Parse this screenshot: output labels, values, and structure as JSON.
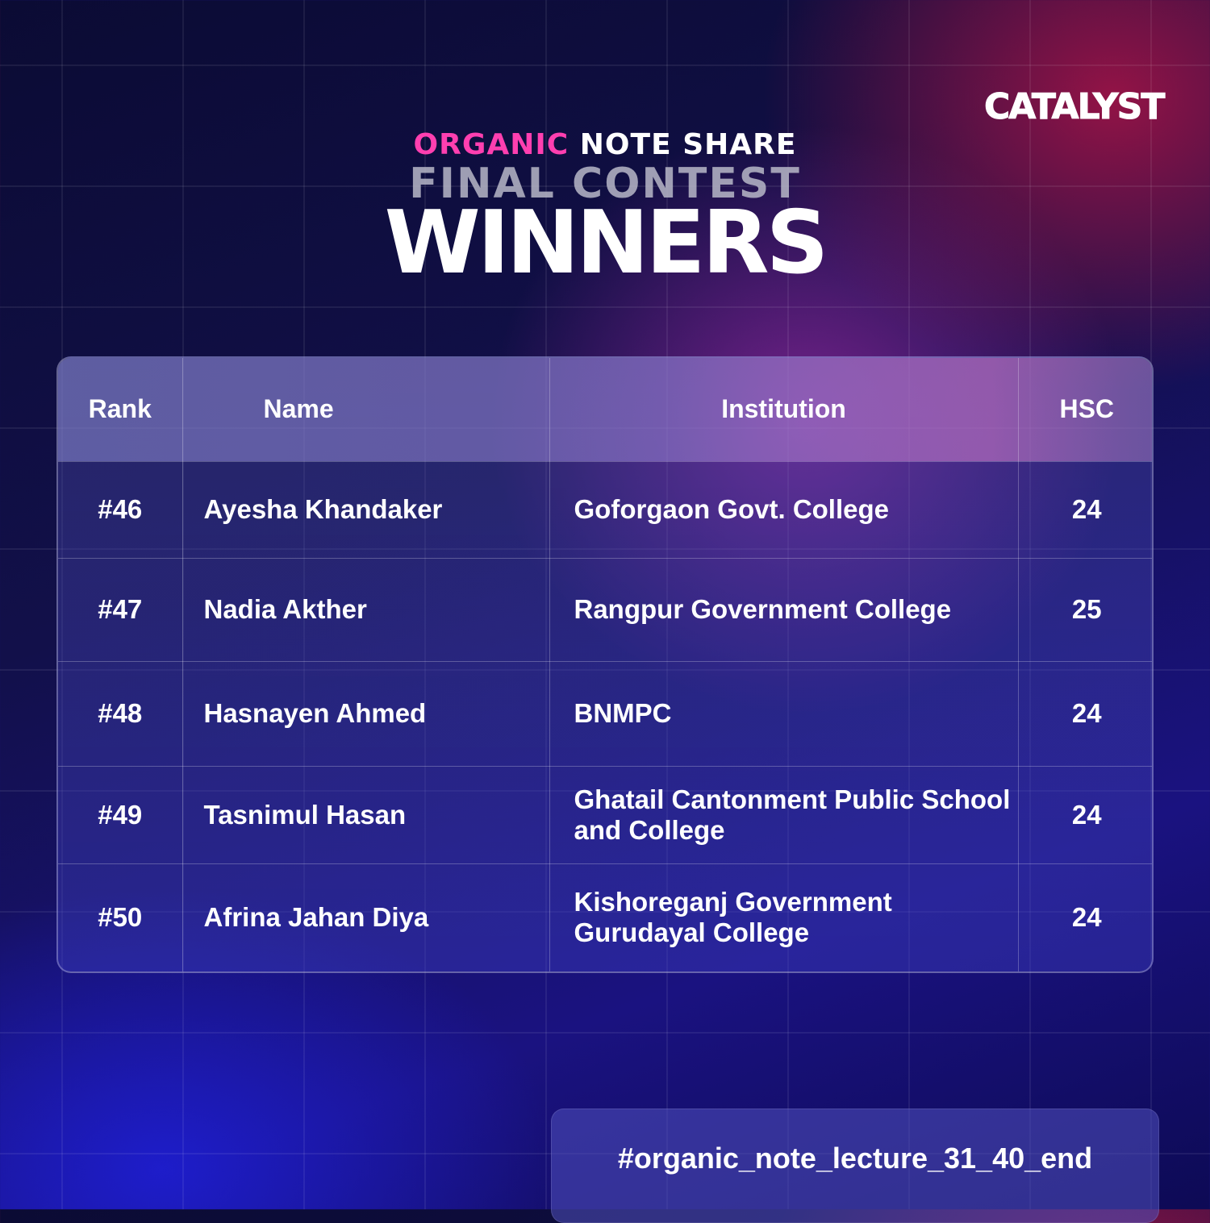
{
  "brand": {
    "logo_text": "CATALYST"
  },
  "header": {
    "line1_pink": "ORGANIC",
    "line1_white": "NOTE SHARE",
    "line2": "FINAL CONTEST",
    "line3": "WINNERS"
  },
  "table": {
    "columns": [
      "Rank",
      "Name",
      "Institution",
      "HSC"
    ],
    "rows": [
      {
        "rank": "#46",
        "name": "Ayesha Khandaker",
        "institution": "Goforgaon Govt. College",
        "hsc": "24"
      },
      {
        "rank": "#47",
        "name": "Nadia Akther",
        "institution": "Rangpur Government College",
        "hsc": "25"
      },
      {
        "rank": "#48",
        "name": "Hasnayen Ahmed",
        "institution": "BNMPC",
        "hsc": "24"
      },
      {
        "rank": "#49",
        "name": "Tasnimul Hasan",
        "institution": "Ghatail Cantonment Public School and College",
        "hsc": "24"
      },
      {
        "rank": "#50",
        "name": "Afrina Jahan Diya",
        "institution": "Kishoreganj Government Gurudayal College",
        "hsc": "24"
      }
    ]
  },
  "footer": {
    "hashtag": "#organic_note_lecture_31_40_end"
  },
  "colors": {
    "accent_pink": "#ff3fb0",
    "background": "#12104a"
  }
}
